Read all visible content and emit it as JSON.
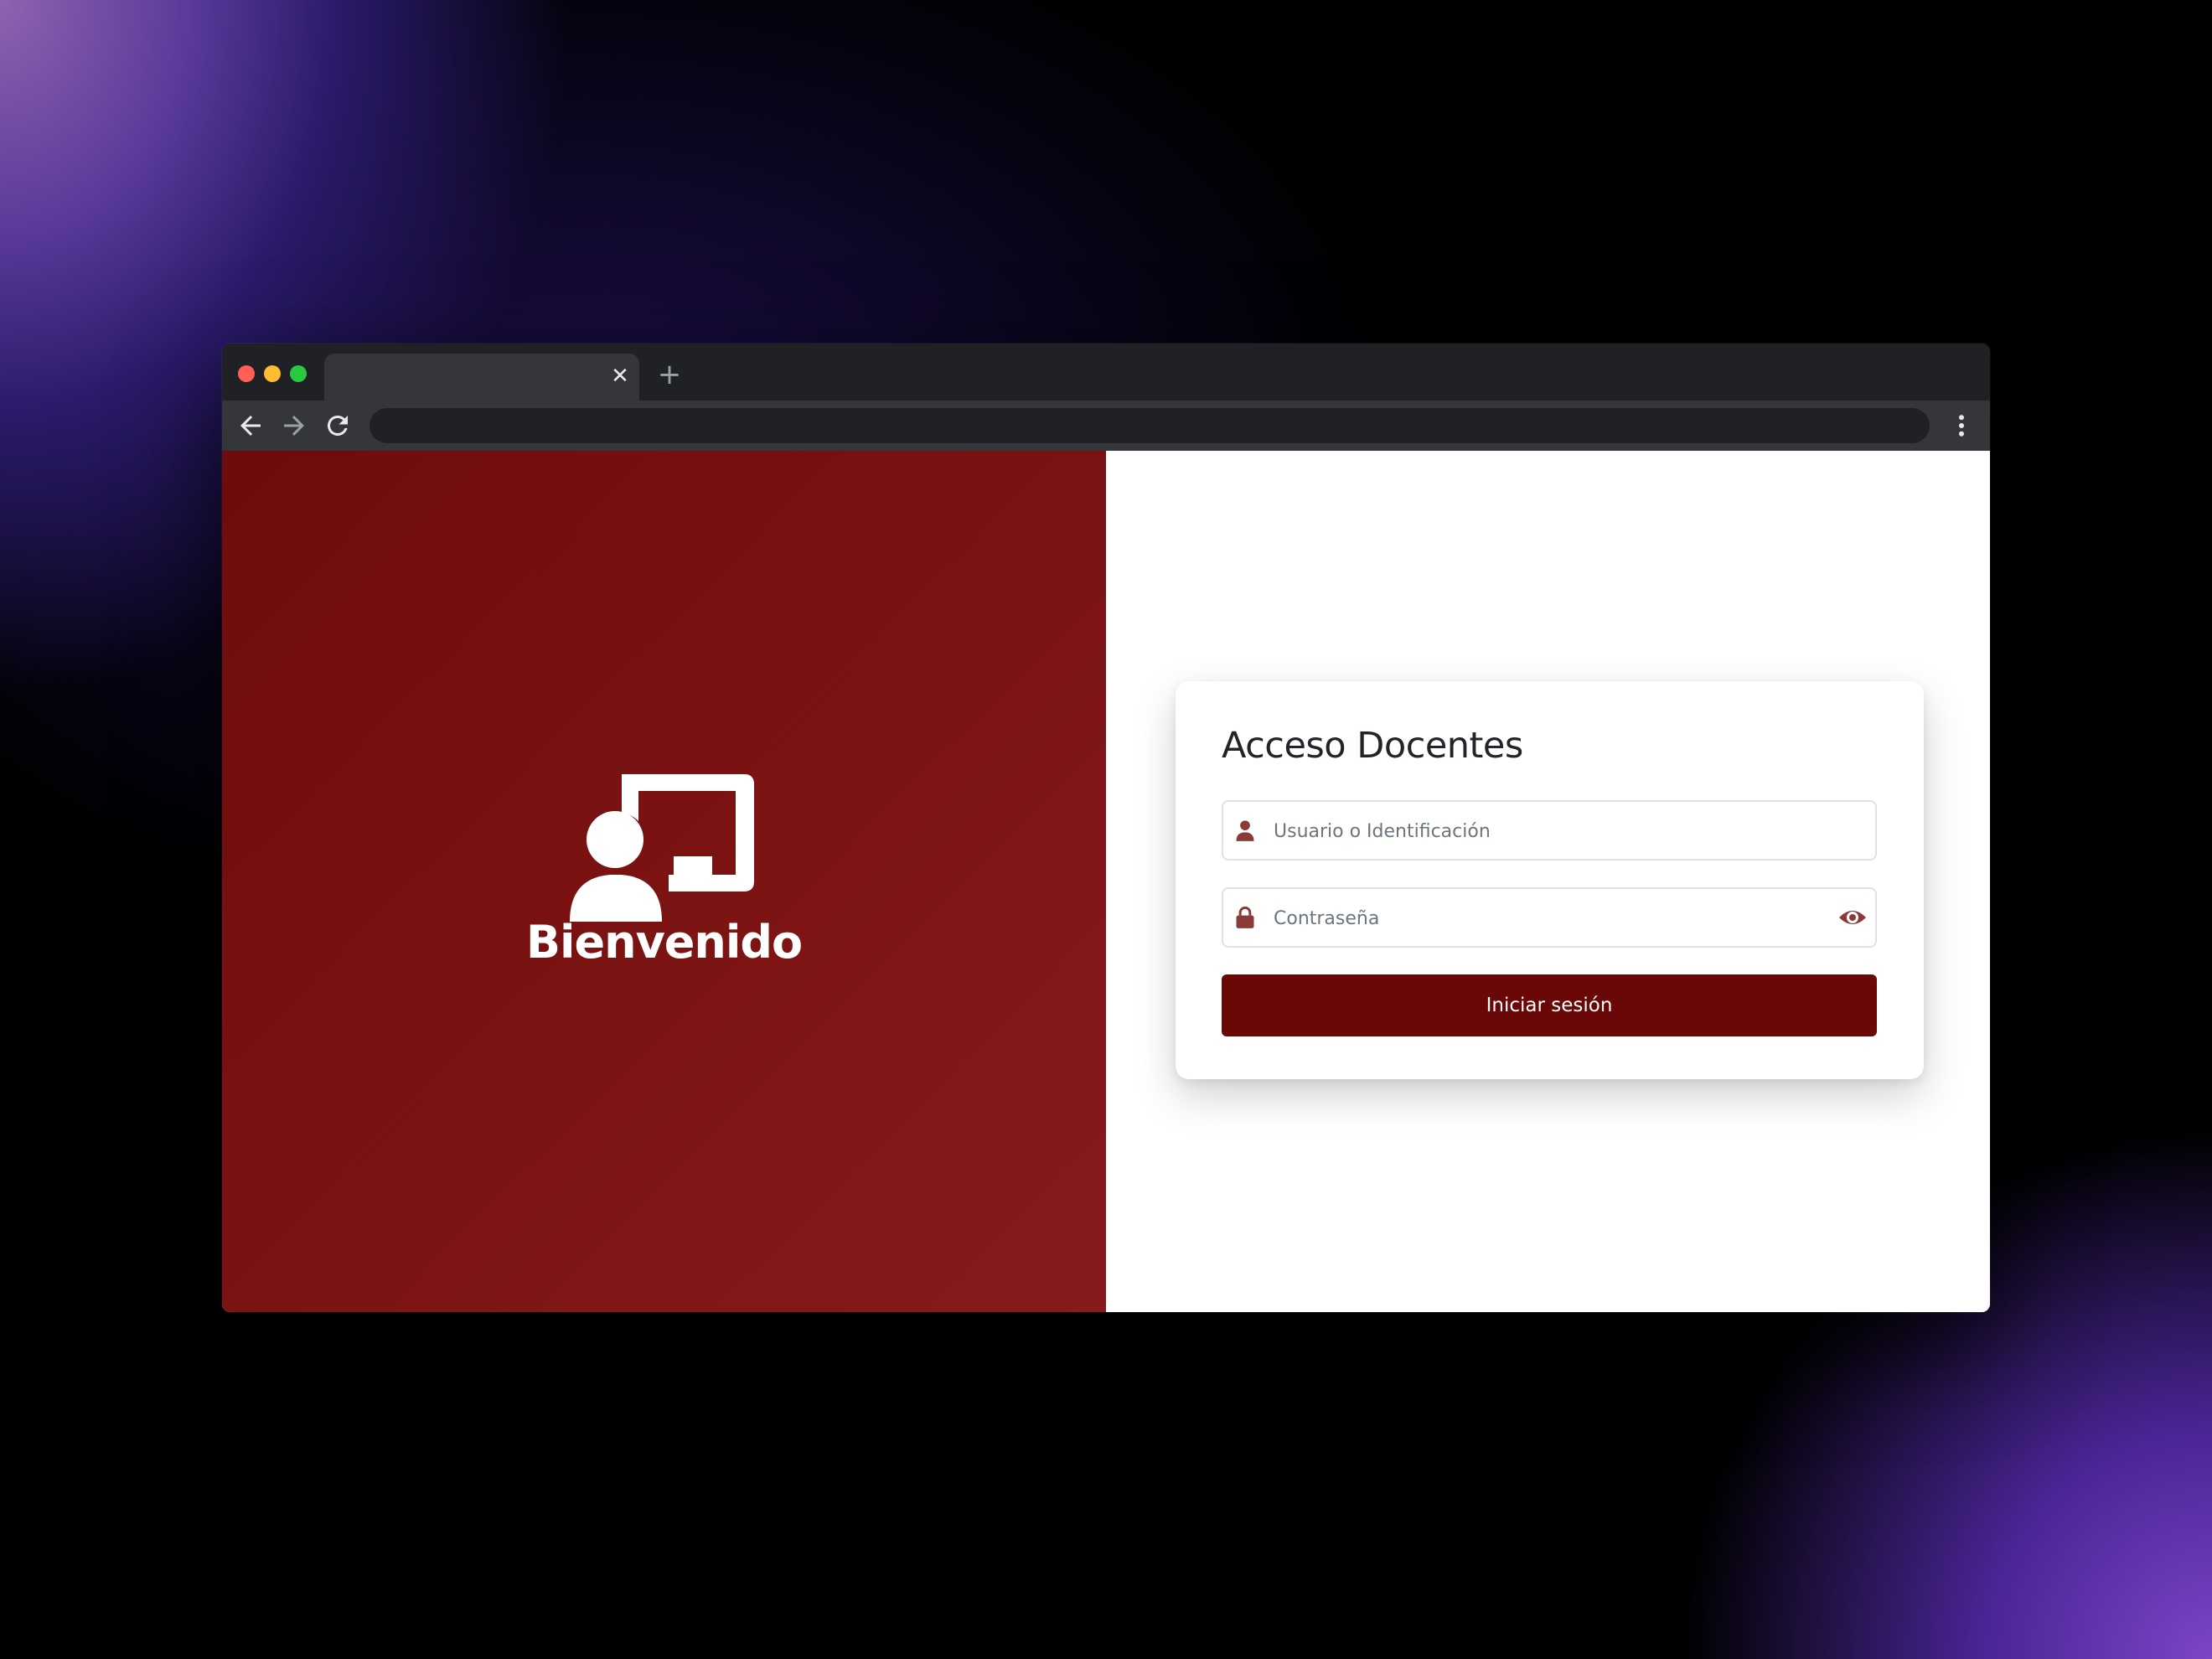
{
  "browser": {
    "tab": {
      "title": "",
      "close_glyph": "✕"
    },
    "new_tab_glyph": "+",
    "address_bar": {
      "value": ""
    },
    "icons": {
      "back": "back-arrow-icon",
      "forward": "forward-arrow-icon",
      "reload": "reload-icon",
      "menu": "kebab-menu-icon"
    }
  },
  "welcome": {
    "icon": "teacher-chalkboard-icon",
    "title": "Bienvenido"
  },
  "login": {
    "title": "Acceso Docentes",
    "username": {
      "placeholder": "Usuario o Identificación",
      "value": "",
      "icon": "user-icon"
    },
    "password": {
      "placeholder": "Contraseña",
      "value": "",
      "icon": "lock-icon",
      "toggle_icon": "eye-icon"
    },
    "submit_label": "Iniciar sesión"
  },
  "colors": {
    "brand": "#6a0707",
    "panel_gradient_start": "#6d0c0c",
    "panel_gradient_end": "#871b1b",
    "icon_accent": "#8b3a3a"
  }
}
